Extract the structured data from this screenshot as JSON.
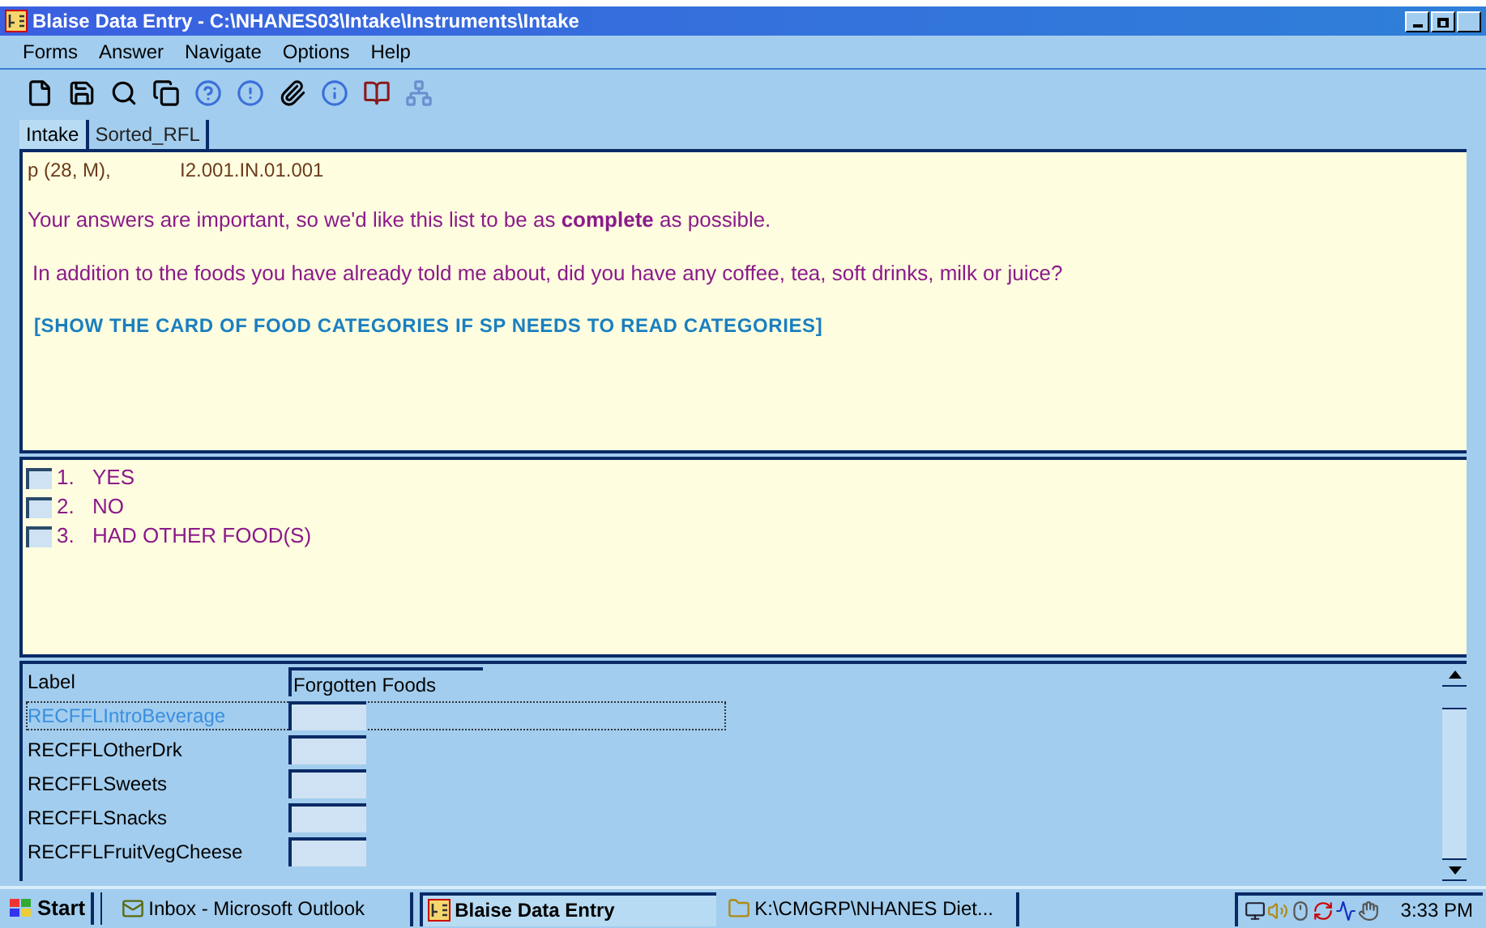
{
  "window": {
    "title": "Blaise Data Entry - C:\\NHANES03\\Intake\\Instruments\\Intake"
  },
  "menu": [
    "Forms",
    "Answer",
    "Navigate",
    "Options",
    "Help"
  ],
  "tabs": [
    {
      "label": "Intake",
      "selected": true
    },
    {
      "label": "Sorted_RFL",
      "selected": false
    }
  ],
  "question": {
    "header": "p (28, M),",
    "code": "I2.001.IN.01.001",
    "intro": "Your answers are important, so we'd like this list to be as **complete** as possible.",
    "text": "In addition to the foods you have already told me about, did you have any coffee, tea, soft drinks, milk or juice?",
    "instruction": "[SHOW THE CARD OF FOOD CATEGORIES IF SP NEEDS TO READ CATEGORIES]"
  },
  "answers": [
    {
      "number": "1.",
      "label": "YES",
      "checked": false
    },
    {
      "number": "2.",
      "label": "NO",
      "checked": false
    },
    {
      "number": "3.",
      "label": "HAD OTHER FOOD(S)",
      "checked": false
    }
  ],
  "grid": {
    "label_header": "Label",
    "column_header": "Forgotten Foods",
    "rows": [
      {
        "name": "RECFFLIntroBeverage",
        "selected": true
      },
      {
        "name": "RECFFLOtherDrk",
        "selected": false
      },
      {
        "name": "RECFFLSweets",
        "selected": false
      },
      {
        "name": "RECFFLSnacks",
        "selected": false
      },
      {
        "name": "RECFFLFruitVegCheese",
        "selected": false
      }
    ]
  },
  "taskbar": {
    "start": "Start",
    "tasks": [
      {
        "label": "Inbox - Microsoft Outlook",
        "kind": "mail",
        "selected": false
      },
      {
        "label": "Blaise Data Entry",
        "kind": "app",
        "selected": true
      },
      {
        "label": "K:\\CMGRP\\NHANES Diet...",
        "kind": "folder",
        "selected": false
      }
    ],
    "clock": "3:33 PM"
  }
}
